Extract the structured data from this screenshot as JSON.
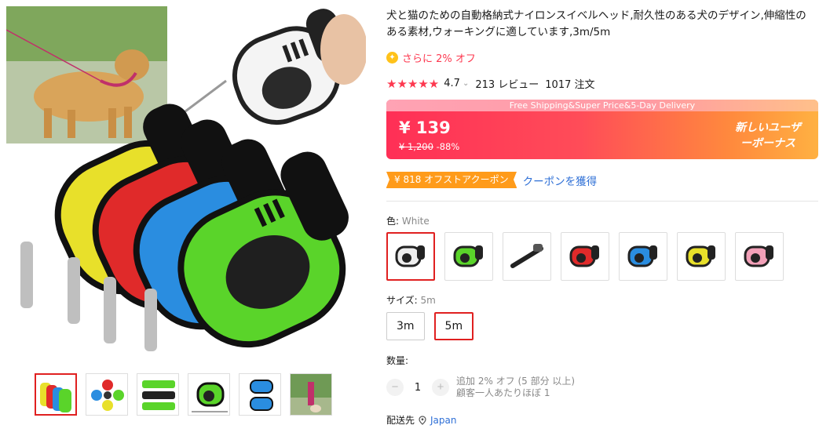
{
  "product": {
    "title": "犬と猫のための自動格納式ナイロンスイベルヘッド,耐久性のある犬のデザイン,伸縮性のある素材,ウォーキングに適しています,3m/5m",
    "extra_off": "さらに 2% オフ",
    "rating": "4.7",
    "reviews": "213 レビュー",
    "orders": "1017 注文"
  },
  "price": {
    "banner": "Free Shipping&Super Price&5-Day Delivery",
    "current": "¥ 139",
    "original": "¥ 1,200",
    "discount": "-88%",
    "new_user_line1": "新しいユーザ",
    "new_user_line2": "ーボーナス"
  },
  "coupon": {
    "badge": "¥ 818 オフストアクーポン",
    "link": "クーポンを獲得"
  },
  "color": {
    "label": "色:",
    "selected": "White",
    "options": [
      "white",
      "green",
      "black",
      "red",
      "blue",
      "yellow",
      "pink"
    ]
  },
  "size": {
    "label": "サイズ:",
    "selected": "5m",
    "options": [
      "3m",
      "5m"
    ]
  },
  "quantity": {
    "label": "数量:",
    "value": "1",
    "minus": "−",
    "plus": "+",
    "note_line1": "追加 2% オフ (5 部分 以上)",
    "note_line2": "顧客一人あたりほぼ 1"
  },
  "shipping": {
    "label": "配送先",
    "location": "Japan"
  },
  "colors_hex": {
    "accent": "#fd384f",
    "link": "#2e6fd6",
    "coupon": "#ff9b1a",
    "leash_green": "#5ad42a",
    "leash_blue": "#2a8de0",
    "leash_red": "#e02a2a",
    "leash_yellow": "#e8e02a"
  }
}
